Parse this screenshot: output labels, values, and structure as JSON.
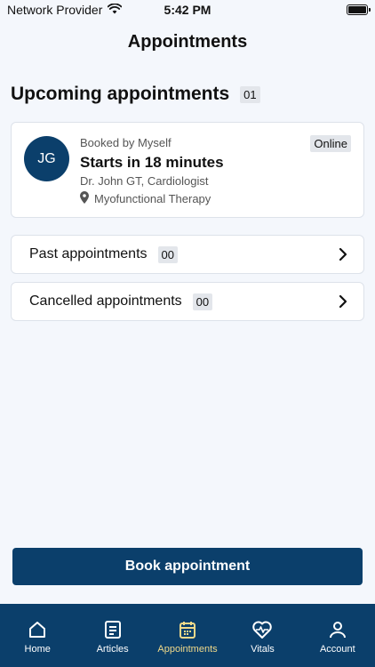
{
  "status_bar": {
    "carrier": "Network Provider",
    "time": "5:42 PM"
  },
  "page_title": "Appointments",
  "upcoming": {
    "title": "Upcoming appointments",
    "count": "01",
    "appointment": {
      "initials": "JG",
      "booked_by": "Booked by Myself",
      "starts_in": "Starts in 18 minutes",
      "doctor": "Dr. John GT, Cardiologist",
      "specialty": "Myofunctional Therapy",
      "mode": "Online"
    }
  },
  "past": {
    "label": "Past appointments",
    "count": "00"
  },
  "cancelled": {
    "label": "Cancelled appointments",
    "count": "00"
  },
  "book_button": "Book appointment",
  "tabs": [
    {
      "label": "Home",
      "icon": "home-icon"
    },
    {
      "label": "Articles",
      "icon": "articles-icon"
    },
    {
      "label": "Appointments",
      "icon": "calendar-icon",
      "active": true
    },
    {
      "label": "Vitals",
      "icon": "heart-pulse-icon"
    },
    {
      "label": "Account",
      "icon": "account-icon"
    }
  ],
  "colors": {
    "primary": "#0b3f6b",
    "active_tab": "#f0d98a",
    "background": "#f4f7fc"
  }
}
